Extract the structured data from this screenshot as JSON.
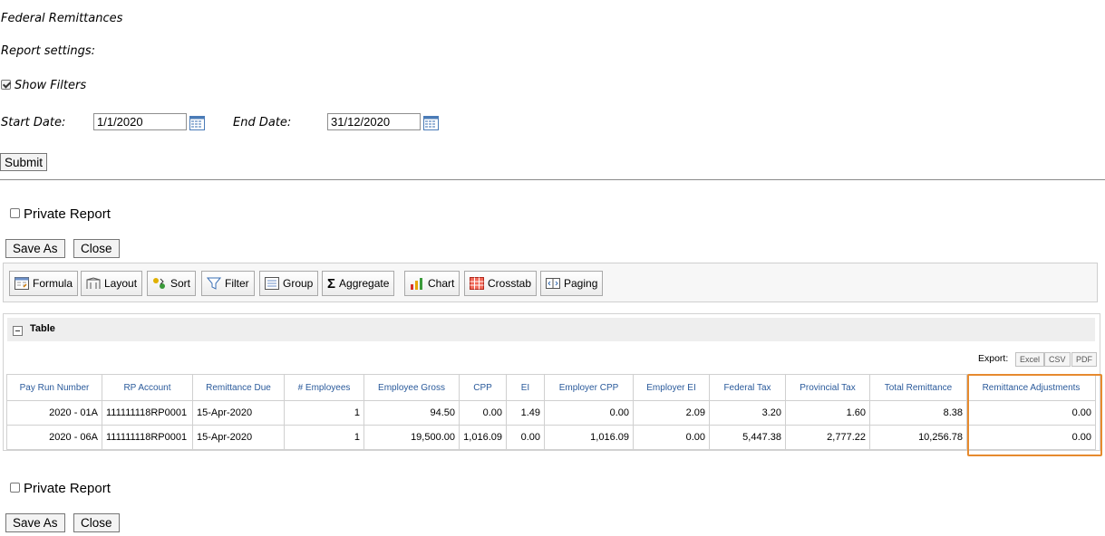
{
  "report": {
    "title": "Federal Remittances",
    "settings_label": "Report settings:",
    "show_filters_label": "Show Filters",
    "start_date_label": "Start Date:",
    "start_date_value": "1/1/2020",
    "end_date_label": "End Date:",
    "end_date_value": "31/12/2020",
    "submit_label": "Submit"
  },
  "top_actions": {
    "private_report_label": "Private Report",
    "save_as_label": "Save As",
    "close_label": "Close"
  },
  "toolbar": {
    "formula": "Formula",
    "layout": "Layout",
    "sort": "Sort",
    "filter": "Filter",
    "group": "Group",
    "aggregate": "Aggregate",
    "chart": "Chart",
    "crosstab": "Crosstab",
    "paging": "Paging"
  },
  "table_panel": {
    "title": "Table",
    "export_label": "Export:",
    "export_excel": "Excel",
    "export_csv": "CSV",
    "export_pdf": "PDF",
    "columns": [
      "Pay Run Number",
      "RP Account",
      "Remittance Due",
      "# Employees",
      "Employee Gross",
      "CPP",
      "EI",
      "Employer CPP",
      "Employer EI",
      "Federal Tax",
      "Provincial Tax",
      "Total Remittance",
      "Remittance Adjustments"
    ],
    "rows": [
      [
        "2020 - 01A",
        "111111118RP0001",
        "15-Apr-2020",
        "1",
        "94.50",
        "0.00",
        "1.49",
        "0.00",
        "2.09",
        "3.20",
        "1.60",
        "8.38",
        "0.00"
      ],
      [
        "2020 - 06A",
        "111111118RP0001",
        "15-Apr-2020",
        "1",
        "19,500.00",
        "1,016.09",
        "0.00",
        "1,016.09",
        "0.00",
        "5,447.38",
        "2,777.22",
        "10,256.78",
        "0.00"
      ]
    ]
  },
  "bottom_actions": {
    "private_report_label": "Private Report",
    "save_as_label": "Save As",
    "close_label": "Close"
  }
}
